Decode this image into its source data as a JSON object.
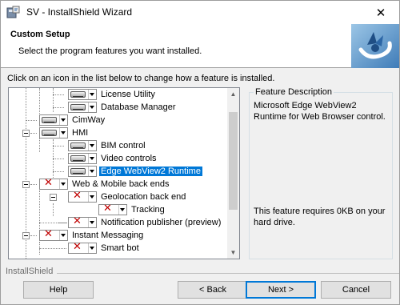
{
  "window": {
    "title": "SV - InstallShield Wizard",
    "close_glyph": "✕"
  },
  "header": {
    "title": "Custom Setup",
    "subtitle": "Select the program features you want installed."
  },
  "instruction": "Click on an icon in the list below to change how a feature is installed.",
  "tree": {
    "items": [
      {
        "label": "License Utility",
        "state": "installed",
        "selected": false
      },
      {
        "label": "Database Manager",
        "state": "installed",
        "selected": false
      },
      {
        "label": "CimWay",
        "state": "installed",
        "selected": false
      },
      {
        "label": "HMI",
        "state": "installed",
        "selected": false
      },
      {
        "label": "BIM control",
        "state": "installed",
        "selected": false
      },
      {
        "label": "Video controls",
        "state": "installed",
        "selected": false
      },
      {
        "label": "Edge WebView2 Runtime",
        "state": "installed",
        "selected": true
      },
      {
        "label": "Web & Mobile back ends",
        "state": "unavailable",
        "selected": false
      },
      {
        "label": "Geolocation back end",
        "state": "unavailable",
        "selected": false
      },
      {
        "label": "Tracking",
        "state": "unavailable",
        "selected": false
      },
      {
        "label": "Notification publisher (preview)",
        "state": "unavailable",
        "selected": false
      },
      {
        "label": "Instant Messaging",
        "state": "unavailable",
        "selected": false
      },
      {
        "label": "Smart bot",
        "state": "unavailable",
        "selected": false
      }
    ]
  },
  "description": {
    "legend": "Feature Description",
    "text": "Microsoft Edge WebView2 Runtime for Web Browser control.",
    "requirement": "This feature requires 0KB on your hard drive."
  },
  "footer": {
    "brand": "InstallShield",
    "help_label": "Help",
    "back_label": "< Back",
    "next_label": "Next >",
    "cancel_label": "Cancel"
  },
  "colors": {
    "selection": "#0078d7",
    "unavailable_mark": "#c00000"
  }
}
